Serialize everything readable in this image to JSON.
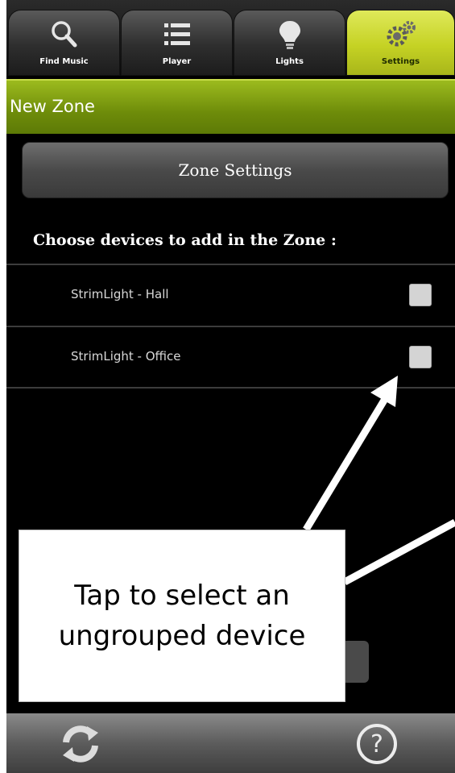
{
  "tabs": [
    {
      "label": "Find Music",
      "icon": "search-icon",
      "active": false
    },
    {
      "label": "Player",
      "icon": "list-icon",
      "active": false
    },
    {
      "label": "Lights",
      "icon": "lightbulb-icon",
      "active": false
    },
    {
      "label": "Settings",
      "icon": "gears-icon",
      "active": true
    }
  ],
  "header": {
    "title": "New Zone"
  },
  "zone_settings": {
    "label": "Zone Settings"
  },
  "choose_label": "Choose devices to add in the Zone :",
  "devices": [
    {
      "name": "StrimLight - Hall",
      "checked": false
    },
    {
      "name": "StrimLight - Office",
      "checked": false
    }
  ],
  "callout": {
    "text": "Tap to select an ungrouped device"
  },
  "bottom_bar": {
    "left_icon": "refresh-icon",
    "right_icon": "help-icon"
  },
  "colors": {
    "accent": "#b5c51f",
    "header_green": "#7a9a10",
    "background": "#000000"
  }
}
